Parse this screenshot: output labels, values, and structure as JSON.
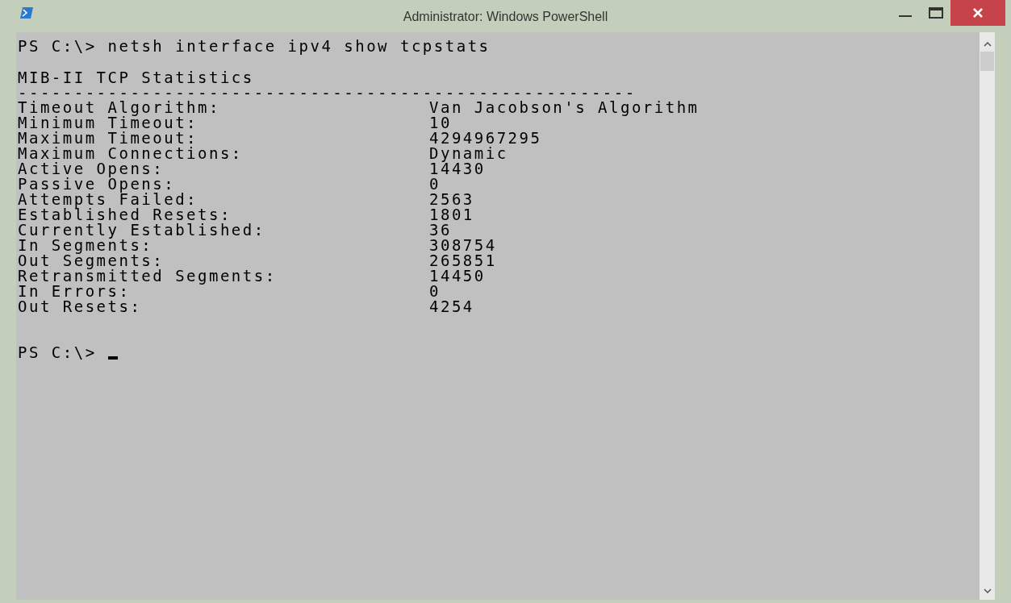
{
  "window": {
    "title": "Administrator: Windows PowerShell"
  },
  "console": {
    "lines": [
      {
        "kind": "command",
        "prompt": "PS C:\\>",
        "text": "netsh interface ipv4 show tcpstats"
      },
      {
        "kind": "blank"
      },
      {
        "kind": "heading",
        "text": "MIB-II TCP Statistics"
      },
      {
        "kind": "rule",
        "text": "-------------------------------------------------------"
      },
      {
        "kind": "stat",
        "label": "Timeout Algorithm:",
        "value": "Van Jacobson's Algorithm"
      },
      {
        "kind": "stat",
        "label": "Minimum Timeout:",
        "value": "10"
      },
      {
        "kind": "stat",
        "label": "Maximum Timeout:",
        "value": "4294967295"
      },
      {
        "kind": "stat",
        "label": "Maximum Connections:",
        "value": "Dynamic"
      },
      {
        "kind": "stat",
        "label": "Active Opens:",
        "value": "14430"
      },
      {
        "kind": "stat",
        "label": "Passive Opens:",
        "value": "0"
      },
      {
        "kind": "stat",
        "label": "Attempts Failed:",
        "value": "2563"
      },
      {
        "kind": "stat",
        "label": "Established Resets:",
        "value": "1801"
      },
      {
        "kind": "stat",
        "label": "Currently Established:",
        "value": "36"
      },
      {
        "kind": "stat",
        "label": "In Segments:",
        "value": "308754"
      },
      {
        "kind": "stat",
        "label": "Out Segments:",
        "value": "265851"
      },
      {
        "kind": "stat",
        "label": "Retransmitted Segments:",
        "value": "14450"
      },
      {
        "kind": "stat",
        "label": "In Errors:",
        "value": "0"
      },
      {
        "kind": "stat",
        "label": "Out Resets:",
        "value": "4254"
      },
      {
        "kind": "blank"
      },
      {
        "kind": "blank"
      },
      {
        "kind": "command",
        "prompt": "PS C:\\>",
        "cursor": true
      }
    ]
  }
}
